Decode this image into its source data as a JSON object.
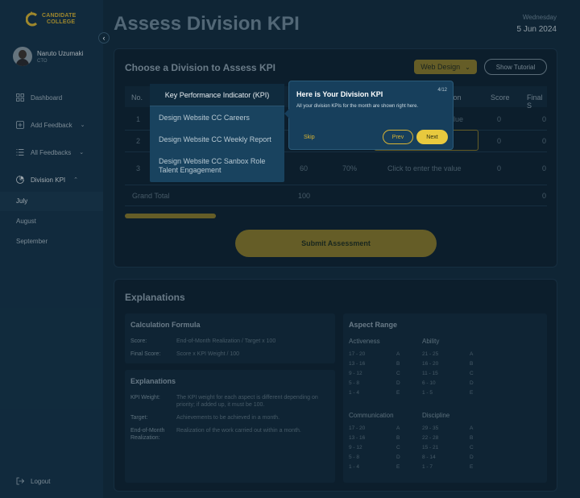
{
  "brand": {
    "line1": "CANDIDATE",
    "line2": "COLLEGE",
    "color": "#d9b433"
  },
  "user": {
    "name": "Naruto Uzumaki",
    "role": "CTO"
  },
  "nav": {
    "dashboard": "Dashboard",
    "add_feedback": "Add Feedback",
    "all_feedbacks": "All Feedbacks",
    "division_kpi": "Division KPI",
    "months": [
      "July",
      "August",
      "September"
    ],
    "logout": "Logout"
  },
  "header": {
    "title": "Assess Division KPI",
    "day": "Wednesday",
    "date": "5 Jun 2024"
  },
  "assess": {
    "title": "Choose a Division to Assess KPI",
    "division": "Web Design",
    "tutorial": "Show Tutorial",
    "columns": {
      "no": "No.",
      "kpi": "Key Performance Indicator (KPI)",
      "realization": "ation",
      "score": "Score",
      "final": "Final S"
    },
    "rows": [
      {
        "no": "1",
        "kpi": "Design Website CC Careers",
        "target": "",
        "weight": "",
        "realization": "lue",
        "score": "0",
        "final": "0"
      },
      {
        "no": "2",
        "kpi": "Design Website CC Weekly Report",
        "target": "",
        "weight": "",
        "realization": "",
        "score": "0",
        "final": "0"
      },
      {
        "no": "3",
        "kpi": "Design Website CC Sanbox Role Talent Engagement",
        "target": "60",
        "weight": "70%",
        "realization": "Click to enter the value",
        "score": "0",
        "final": "0"
      }
    ],
    "total": {
      "label": "Grand Total",
      "target": "100",
      "final": "0"
    },
    "submit": "Submit Assessment"
  },
  "tooltip": {
    "title": "Here is Your Division KPI",
    "step": "4/12",
    "body": "All your division KPIs for the month are shown right here.",
    "skip": "Skip",
    "prev": "Prev",
    "next": "Next"
  },
  "explanations": {
    "title": "Explanations",
    "calc": {
      "title": "Calculation Formula",
      "score_label": "Score:",
      "score_value": "End-of-Month Realization / Target x 100",
      "final_label": "Final Score:",
      "final_value": "Score x KPI Weight / 100"
    },
    "defs": {
      "title": "Explanations",
      "weight_label": "KPI Weight:",
      "weight_value": "The KPI weight for each aspect is different depending on priority; if added up, it must be 100.",
      "target_label": "Target:",
      "target_value": "Achievements to be achieved in a month.",
      "real_label": "End-of-Month Realization:",
      "real_value": "Realization of the work carried out within a month."
    },
    "aspect": {
      "title": "Aspect Range",
      "groups": [
        {
          "name": "Activeness",
          "rows": [
            [
              "17 - 20",
              "A"
            ],
            [
              "13 - 16",
              "B"
            ],
            [
              "9 - 12",
              "C"
            ],
            [
              "5 - 8",
              "D"
            ],
            [
              "1 - 4",
              "E"
            ]
          ]
        },
        {
          "name": "Ability",
          "rows": [
            [
              "21 - 25",
              "A"
            ],
            [
              "16 - 20",
              "B"
            ],
            [
              "11 - 15",
              "C"
            ],
            [
              "6 - 10",
              "D"
            ],
            [
              "1 - 5",
              "E"
            ]
          ]
        },
        {
          "name": "Communication",
          "rows": [
            [
              "17 - 20",
              "A"
            ],
            [
              "13 - 16",
              "B"
            ],
            [
              "9 - 12",
              "C"
            ],
            [
              "5 - 8",
              "D"
            ],
            [
              "1 - 4",
              "E"
            ]
          ]
        },
        {
          "name": "Discipline",
          "rows": [
            [
              "29 - 35",
              "A"
            ],
            [
              "22 - 28",
              "B"
            ],
            [
              "15 - 21",
              "C"
            ],
            [
              "8 - 14",
              "D"
            ],
            [
              "1 - 7",
              "E"
            ]
          ]
        }
      ]
    }
  }
}
